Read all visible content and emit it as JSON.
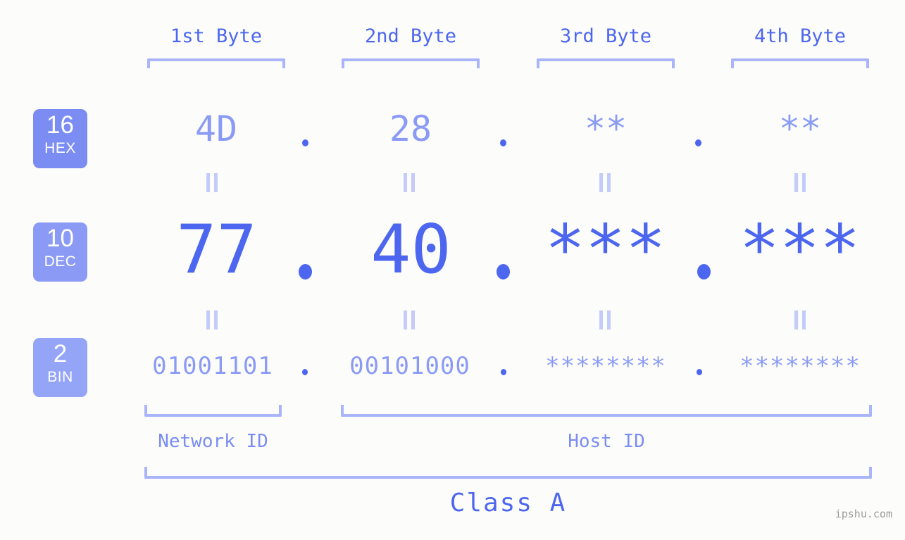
{
  "page": {
    "background_color": "#fcfdfa",
    "accent_dark": "#4d66ef",
    "accent_light": "#8b9bf5",
    "bracket_color": "#aab4fb",
    "watermark": "ipshu.com"
  },
  "byte_headers": [
    {
      "label": "1st Byte"
    },
    {
      "label": "2nd Byte"
    },
    {
      "label": "3rd Byte"
    },
    {
      "label": "4th Byte"
    }
  ],
  "bases": [
    {
      "num": "16",
      "abbr": "HEX",
      "color": "#7b8cf2"
    },
    {
      "num": "10",
      "abbr": "DEC",
      "color": "#8b9bf5"
    },
    {
      "num": "2",
      "abbr": "BIN",
      "color": "#94a5f8"
    }
  ],
  "rows": {
    "hex": {
      "values": [
        "4D",
        "28",
        "**",
        "**"
      ]
    },
    "dec": {
      "values": [
        "77",
        "40",
        "***",
        "***"
      ]
    },
    "bin": {
      "values": [
        "01001101",
        "00101000",
        "********",
        "********"
      ]
    }
  },
  "separators": {
    "symbol": "."
  },
  "equals": {
    "symbol": "||"
  },
  "id_labels": {
    "network": "Network ID",
    "host": "Host ID"
  },
  "class_label": "Class A"
}
